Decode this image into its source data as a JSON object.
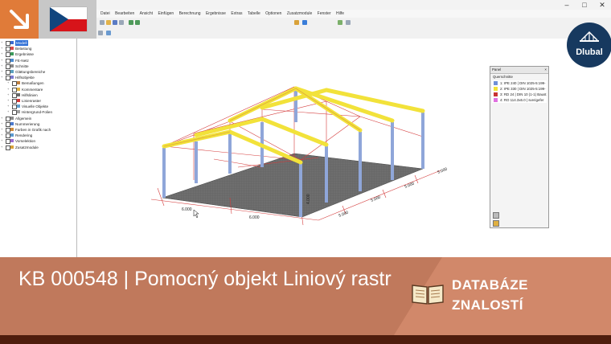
{
  "app": {
    "menu": [
      "Datei",
      "Bearbeiten",
      "Ansicht",
      "Einfügen",
      "Berechnung",
      "Ergebnisse",
      "Extras",
      "Tabelle",
      "Optionen",
      "Zusatzmodule",
      "Fenster",
      "Hilfe"
    ],
    "window_controls": [
      "–",
      "□",
      "✕"
    ]
  },
  "navigator": {
    "items": [
      {
        "label": "Modell",
        "selected": true
      },
      {
        "label": "Belastung"
      },
      {
        "label": "Ergebnisse"
      },
      {
        "label": "FE-Netz"
      },
      {
        "label": "Schnitte"
      },
      {
        "label": "Glättungsbereiche"
      },
      {
        "label": "Hilfsobjekte"
      },
      {
        "label": "Bemaßungen"
      },
      {
        "label": "Kommentare"
      },
      {
        "label": "Hilfslinien"
      },
      {
        "label": "Linienraster"
      },
      {
        "label": "Visuelle Objekte"
      },
      {
        "label": "Hintergrund-Folien"
      },
      {
        "label": "Allgemein"
      },
      {
        "label": "Nummerierung"
      },
      {
        "label": "Farben in Grafik nach"
      },
      {
        "label": "Rendering"
      },
      {
        "label": "Vorselektion"
      },
      {
        "label": "Zusatzmodule"
      }
    ]
  },
  "panel": {
    "title": "Panel",
    "close": "×",
    "section": "Querschnitte",
    "items": [
      {
        "label": "1: IPE 240 | DIN 1025-5:199-",
        "color": "#6f8fd8"
      },
      {
        "label": "2: IPE 330 | DIN 1025-5:199-",
        "color": "#f2e23a"
      },
      {
        "label": "3: RD 24 | DIN 10 (1-1) Baust",
        "color": "#c73333"
      },
      {
        "label": "4: RO 114.3x6.0 | sverigefer",
        "color": "#e070e0"
      }
    ]
  },
  "dimensions": [
    "6.000",
    "6.000",
    "5.000",
    "5.000",
    "5.000",
    "5.000",
    "4.000"
  ],
  "logo": {
    "text": "Dlubal"
  },
  "banner": {
    "title": "KB 000548 | Pomocný objekt Liniový rastr",
    "kb_label_line1": "DATABÁZE",
    "kb_label_line2": "ZNALOSTÍ"
  },
  "colors": {
    "banner": "#c0795c",
    "banner_right": "#d1886a",
    "banner_bottom": "#4f1d0d",
    "accent_orange": "#e07b39",
    "beam_yellow": "#f2e23a",
    "column_blue": "#8fa6d9",
    "grid_red": "#d43b3b",
    "slab": "#6e6e6e",
    "logo_bg": "#17395f"
  }
}
